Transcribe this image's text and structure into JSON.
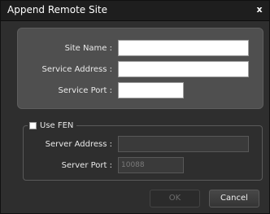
{
  "window": {
    "title": "Append Remote Site",
    "close_glyph": "x"
  },
  "site": {
    "site_name_label": "Site Name :",
    "site_name_value": "",
    "service_address_label": "Service Address :",
    "service_address_value": "",
    "service_port_label": "Service Port :",
    "service_port_value": ""
  },
  "fen": {
    "checkbox_label": "Use FEN",
    "checked": false,
    "server_address_label": "Server Address :",
    "server_address_value": "",
    "server_port_label": "Server Port :",
    "server_port_value": "10088"
  },
  "buttons": {
    "ok_label": "OK",
    "cancel_label": "Cancel"
  }
}
